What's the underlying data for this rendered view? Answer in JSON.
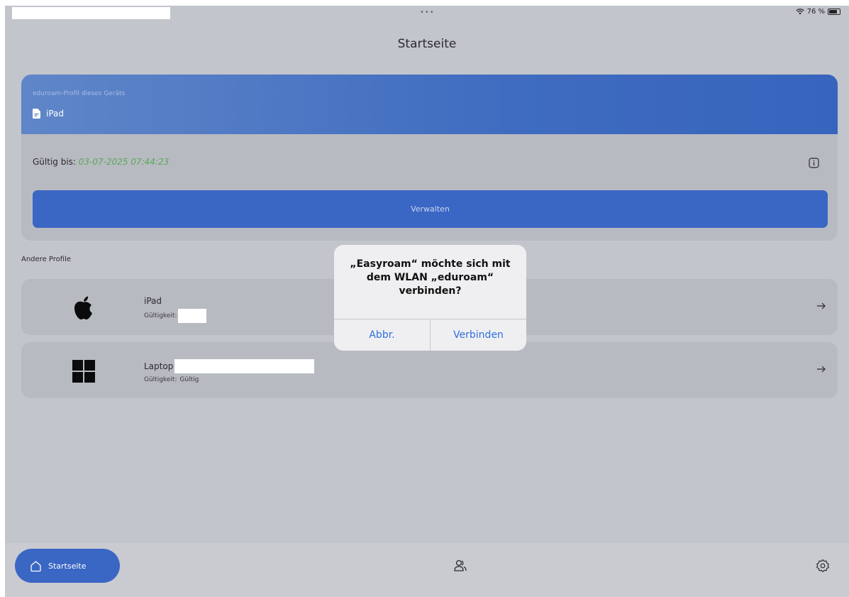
{
  "status_bar": {
    "multitask_dots": "•••",
    "battery_text": "76 %"
  },
  "header": {
    "title": "Startseite"
  },
  "current_profile": {
    "subtitle": "eduroam-Profil dieses Geräts",
    "device_name": "iPad",
    "valid_label": "Gültig bis:",
    "valid_date": "03-07-2025 07:44:23",
    "manage_label": "Verwalten"
  },
  "other_profiles": {
    "section_label": "Andere Profile",
    "items": [
      {
        "name": "iPad",
        "validity_label": "Gültigkeit:",
        "validity_value": "",
        "os_icon": "apple-logo-icon"
      },
      {
        "name": "Laptop",
        "validity_label": "Gültigkeit:",
        "validity_value": "Gültig",
        "os_icon": "windows-logo-icon"
      }
    ]
  },
  "alert": {
    "title": "„Easyroam“ möchte sich mit dem WLAN „eduroam“ verbinden?",
    "cancel_label": "Abbr.",
    "confirm_label": "Verbinden"
  },
  "tabbar": {
    "home_label": "Startseite",
    "people_icon": "people-icon",
    "settings_icon": "gear-icon"
  },
  "colors": {
    "accent": "#3a66c4",
    "valid_date": "#5aa85a",
    "alert_button": "#2f6fdc"
  }
}
